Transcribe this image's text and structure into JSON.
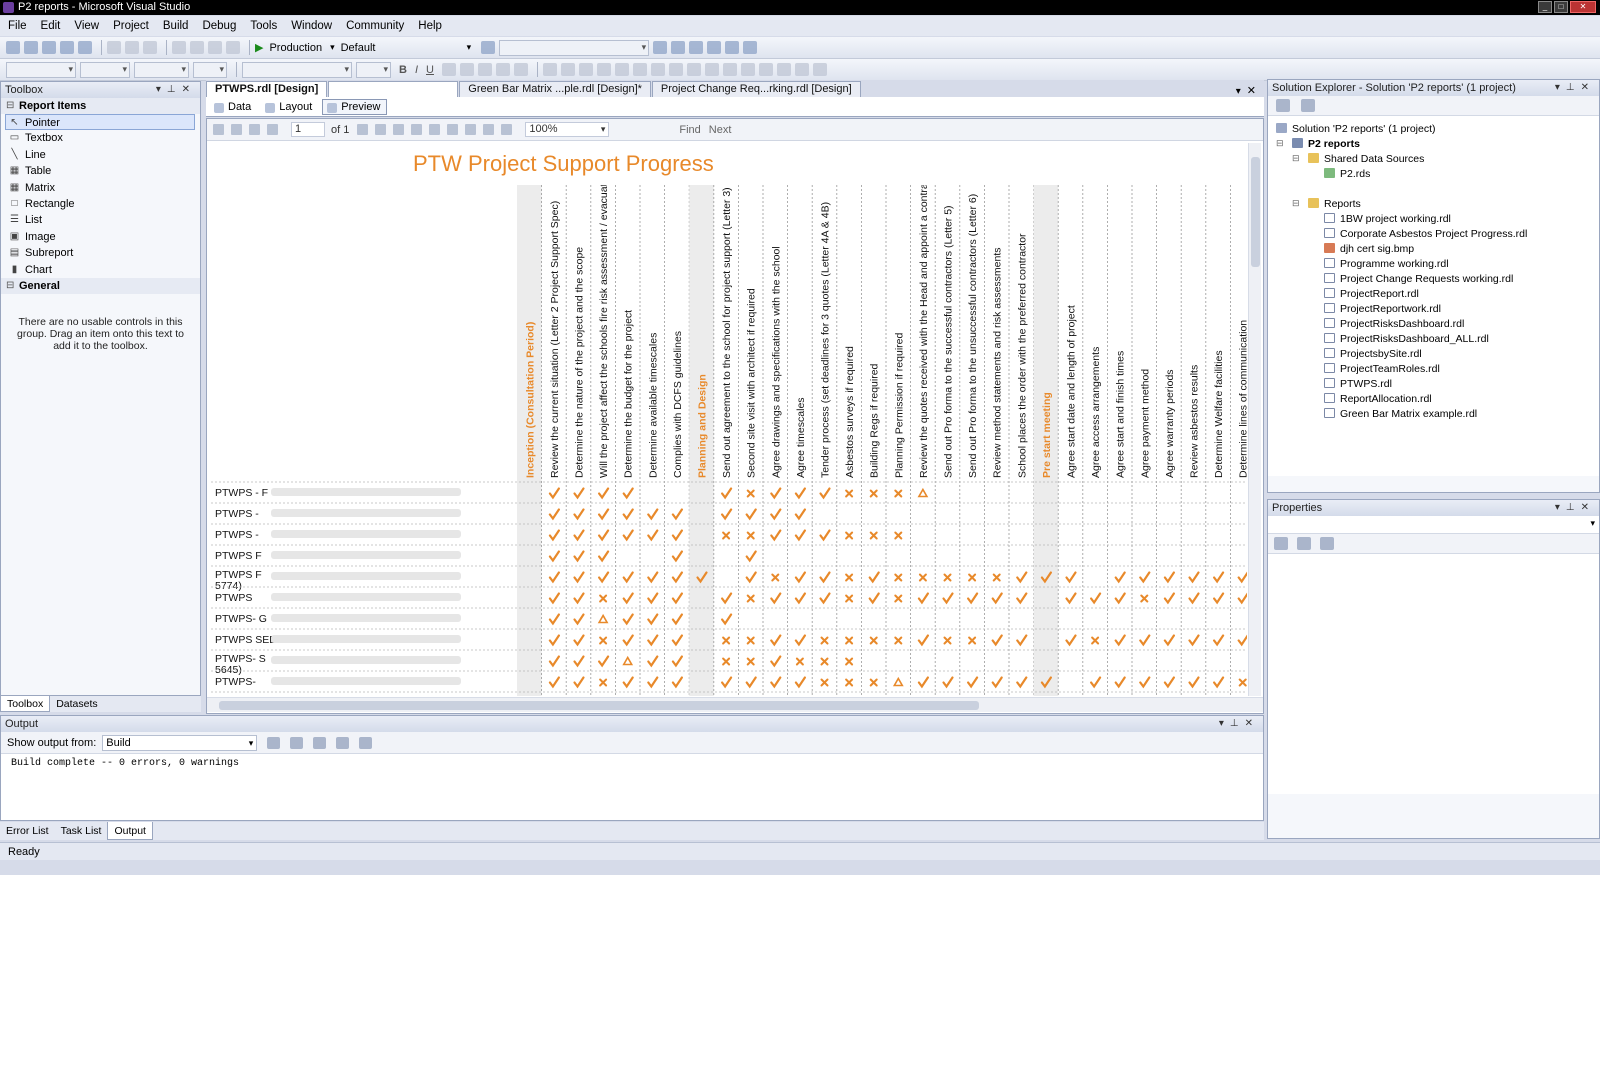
{
  "window": {
    "title": "P2 reports - Microsoft Visual Studio"
  },
  "menu": [
    "File",
    "Edit",
    "View",
    "Project",
    "Build",
    "Debug",
    "Tools",
    "Window",
    "Community",
    "Help"
  ],
  "toolbar": {
    "config": "Production",
    "platform": "Default"
  },
  "toolbox": {
    "title": "Toolbox",
    "group_report_items": "Report Items",
    "items": [
      {
        "label": "Pointer",
        "icon": "pointer-icon",
        "glyph": "↖"
      },
      {
        "label": "Textbox",
        "icon": "textbox-icon",
        "glyph": "▭"
      },
      {
        "label": "Line",
        "icon": "line-icon",
        "glyph": "╲"
      },
      {
        "label": "Table",
        "icon": "table-icon",
        "glyph": "▦"
      },
      {
        "label": "Matrix",
        "icon": "matrix-icon",
        "glyph": "▦"
      },
      {
        "label": "Rectangle",
        "icon": "rectangle-icon",
        "glyph": "□"
      },
      {
        "label": "List",
        "icon": "list-icon",
        "glyph": "☰"
      },
      {
        "label": "Image",
        "icon": "image-icon",
        "glyph": "▣"
      },
      {
        "label": "Subreport",
        "icon": "subreport-icon",
        "glyph": "▤"
      },
      {
        "label": "Chart",
        "icon": "chart-icon",
        "glyph": "▮"
      }
    ],
    "group_general": "General",
    "empty_message": "There are no usable controls in this group. Drag an item onto this text to add it to the toolbox.",
    "tabs": [
      "Toolbox",
      "Datasets"
    ]
  },
  "doc_tabs": [
    "PTWPS.rdl [Design]",
    "",
    "Green Bar Matrix ...ple.rdl [Design]*",
    "Project Change Req...rking.rdl [Design]"
  ],
  "sub_tabs": [
    "Data",
    "Layout",
    "Preview"
  ],
  "preview": {
    "page": "1",
    "page_of": "of 1",
    "zoom": "100%",
    "find": "Find",
    "next": "Next",
    "report_title": "PTW Project Support Progress",
    "columns": [
      {
        "label": "Inception (Consultation Period)",
        "phase": true
      },
      {
        "label": "Review the current situation (Letter 2 Project Support Spec)"
      },
      {
        "label": "Determine the nature of the project and the scope"
      },
      {
        "label": "Will the project affect the schools fire risk assessment / evacuation plan"
      },
      {
        "label": "Determine the budget for the project"
      },
      {
        "label": "Determine available timescales"
      },
      {
        "label": "Complies with DCFS guidelines"
      },
      {
        "label": "Planning and Design",
        "phase": true
      },
      {
        "label": "Send out agreement to the school for project support (Letter 3)"
      },
      {
        "label": "Second site visit with architect if required"
      },
      {
        "label": "Agree drawings and specifications with the school"
      },
      {
        "label": "Agree timescales"
      },
      {
        "label": "Tender process (set deadlines for 3 quotes (Letter 4A & 4B)"
      },
      {
        "label": "Asbestos surveys if required"
      },
      {
        "label": "Building Regs if required"
      },
      {
        "label": "Planning Permission if required"
      },
      {
        "label": "Review the quotes received with the Head and appoint a contractor"
      },
      {
        "label": "Send out Pro forma to the successful contractors (Letter 5)"
      },
      {
        "label": "Send out Pro forma to the unsuccessful contractors (Letter 6)"
      },
      {
        "label": "Review method statements and risk assessments"
      },
      {
        "label": "School places the order with the preferred contractor"
      },
      {
        "label": "Pre start meeting",
        "phase": true
      },
      {
        "label": "Agree start date and length of project"
      },
      {
        "label": "Agree access arrangements"
      },
      {
        "label": "Agree start and finish times"
      },
      {
        "label": "Agree payment method"
      },
      {
        "label": "Agree warranty periods"
      },
      {
        "label": "Review asbestos results"
      },
      {
        "label": "Determine Welfare facilities"
      },
      {
        "label": "Determine lines of communication"
      }
    ],
    "rows": [
      {
        "name": "PTWPS - F",
        "cells": "_cccc___cxcccxxxw________"
      },
      {
        "name": "PTWPS - ",
        "cells": "_cccccc_cccc_____________"
      },
      {
        "name": "PTWPS - ",
        "cells": "_cccccc_xxcccxxx_________"
      },
      {
        "name": "PTWPS F",
        "cells": "_ccc__c__c_______________"
      },
      {
        "name": "PTWPS F",
        "name2": "5774)",
        "cells": "_ccccccc_cxccxcxxxxxccc_ccccccccc"
      },
      {
        "name": "PTWPS ",
        "cells": "_ccxccc_cxcccxcxccccc_cccxcccc"
      },
      {
        "name": "PTWPS- G",
        "cells": "_ccwccc_c____________________"
      },
      {
        "name": "PTWPS SEED-R",
        "cells": "_ccxccc_xxccxxxxcxxcc_cxcccccc"
      },
      {
        "name": "PTWPS- S",
        "name2": "5645)",
        "cells": "_cccwcc_xxcxxx_______________"
      },
      {
        "name": "PTWPS-",
        "cells": "_ccxccc_ccccxxxwcccccc_ccccccxcc"
      }
    ]
  },
  "solution_explorer": {
    "title": "Solution Explorer - Solution 'P2 reports' (1 project)",
    "solution": "Solution 'P2 reports' (1 project)",
    "project": "P2 reports",
    "shared_folder": "Shared Data Sources",
    "data_source": "P2.rds",
    "reports_folder": "Reports",
    "reports": [
      "1BW project working.rdl",
      "Corporate Asbestos Project Progress.rdl",
      "djh cert sig.bmp",
      "Programme working.rdl",
      "Project Change Requests working.rdl",
      "ProjectReport.rdl",
      "ProjectReportwork.rdl",
      "ProjectRisksDashboard.rdl",
      "ProjectRisksDashboard_ALL.rdl",
      "ProjectsbySite.rdl",
      "ProjectTeamRoles.rdl",
      "PTWPS.rdl",
      "ReportAllocation.rdl",
      "Green Bar Matrix example.rdl"
    ]
  },
  "properties": {
    "title": "Properties"
  },
  "output": {
    "title": "Output",
    "show_from_label": "Show output from:",
    "source": "Build",
    "text": "Build complete -- 0 errors, 0 warnings"
  },
  "bottom_tabs": [
    "Error List",
    "Task List",
    "Output"
  ],
  "status": "Ready",
  "colors": {
    "accent": "#e8892a",
    "phase_header": "#e8892a"
  }
}
